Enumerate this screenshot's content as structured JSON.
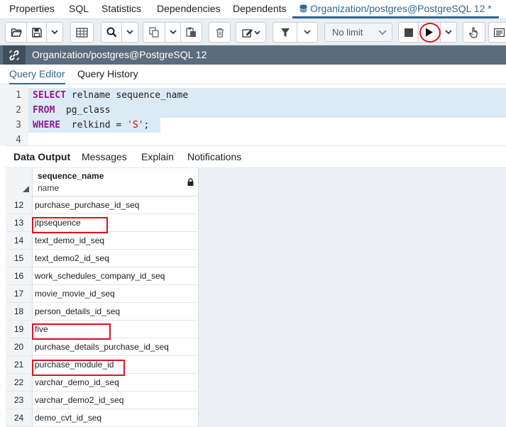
{
  "top_tabs": [
    "Properties",
    "SQL",
    "Statistics",
    "Dependencies",
    "Dependents",
    "Organization/postgres@PostgreSQL 12 *"
  ],
  "toolbar": {
    "limit_value": "No limit",
    "icons": [
      "open-file-icon",
      "save-icon",
      "chevron-down-icon",
      "grid-icon",
      "search-icon",
      "chevron-down-icon",
      "copy-icon",
      "chevron-down-icon",
      "paste-icon",
      "trash-icon",
      "edit-icon",
      "chevron-down-icon",
      "filter-icon",
      "chevron-down-icon",
      "stop-icon",
      "execute-icon",
      "chevron-down-icon",
      "hand-icon",
      "list-icon"
    ]
  },
  "panel": {
    "title": "Organization/postgres@PostgreSQL 12"
  },
  "editor_tabs": [
    "Query Editor",
    "Query History"
  ],
  "editor": {
    "line_numbers": [
      "1",
      "2",
      "3",
      "4"
    ],
    "lines": [
      {
        "keyword": "SELECT",
        "rest": " relname sequence_name"
      },
      {
        "keyword": "FROM",
        "rest": "  pg_class"
      },
      {
        "keyword": "WHERE",
        "rest": "  relkind = ",
        "string": "'S'",
        "tail": ";"
      }
    ]
  },
  "result_tabs": [
    "Data Output",
    "Messages",
    "Explain",
    "Notifications"
  ],
  "grid": {
    "column": {
      "name": "sequence_name",
      "type": "name"
    },
    "rows": [
      {
        "num": "12",
        "value": "purchase_purchase_id_seq"
      },
      {
        "num": "13",
        "value": "jtpsequence"
      },
      {
        "num": "14",
        "value": "text_demo_id_seq"
      },
      {
        "num": "15",
        "value": "text_demo2_id_seq"
      },
      {
        "num": "16",
        "value": "work_schedules_company_id_seq"
      },
      {
        "num": "17",
        "value": "movie_movie_id_seq"
      },
      {
        "num": "18",
        "value": "person_details_id_seq"
      },
      {
        "num": "19",
        "value": "five"
      },
      {
        "num": "20",
        "value": "purchase_details_purchase_id_seq"
      },
      {
        "num": "21",
        "value": "purchase_module_id"
      },
      {
        "num": "22",
        "value": "varchar_demo_id_seq"
      },
      {
        "num": "23",
        "value": "varchar_demo2_id_seq"
      },
      {
        "num": "24",
        "value": "demo_cvt_id_seq"
      }
    ]
  },
  "colors": {
    "accent": "#326690",
    "highlight": "#d8141e",
    "panel": "#5b6d7c",
    "keyword": "#8e1b8e",
    "string": "#b31515"
  }
}
